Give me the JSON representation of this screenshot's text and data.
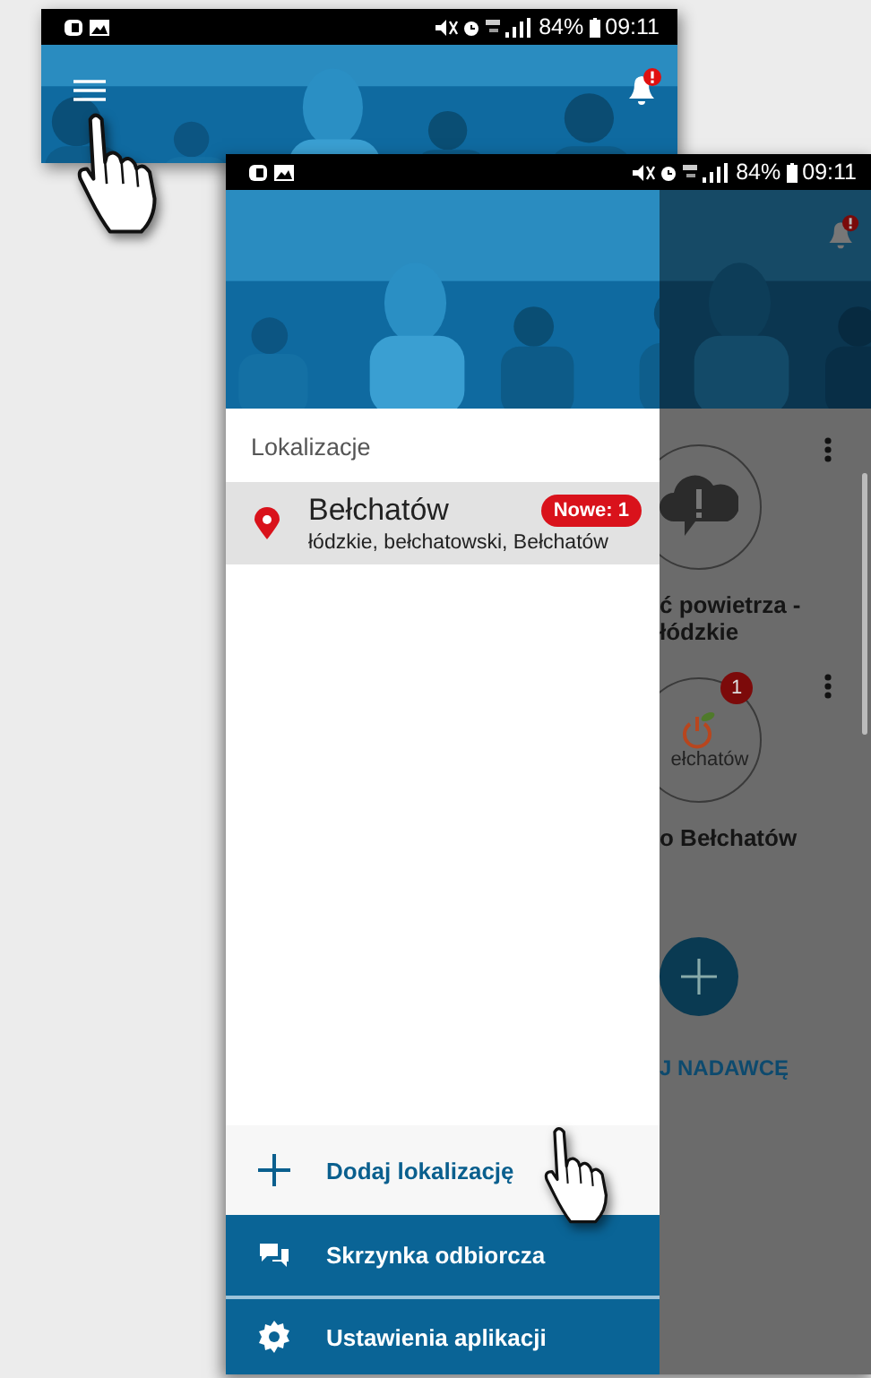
{
  "top_screenshot": {
    "status_bar": {
      "battery": "84%",
      "time": "09:11"
    }
  },
  "main_screenshot": {
    "status_bar": {
      "battery": "84%",
      "time": "09:11"
    },
    "drawer": {
      "section_title": "Lokalizacje",
      "locations": [
        {
          "name": "Bełchatów",
          "region": "łódzkie, bełchatowski, Bełchatów",
          "badge": "Nowe: 1",
          "selected": true
        }
      ],
      "actions": [
        {
          "kind": "add",
          "label": "Dodaj lokalizację"
        },
        {
          "kind": "inbox",
          "label": "Skrzynka odbiorcza"
        },
        {
          "kind": "settings",
          "label": "Ustawienia aplikacji"
        }
      ]
    },
    "background": {
      "cards": [
        {
          "kind": "alert",
          "lines": [
            "ć powietrza -",
            "łódzkie"
          ]
        },
        {
          "kind": "logo",
          "circle_text": "ełchatów",
          "badge": "1",
          "lines": [
            "o Bełchatów"
          ]
        }
      ],
      "fab_label": "J NADAWCĘ"
    }
  }
}
